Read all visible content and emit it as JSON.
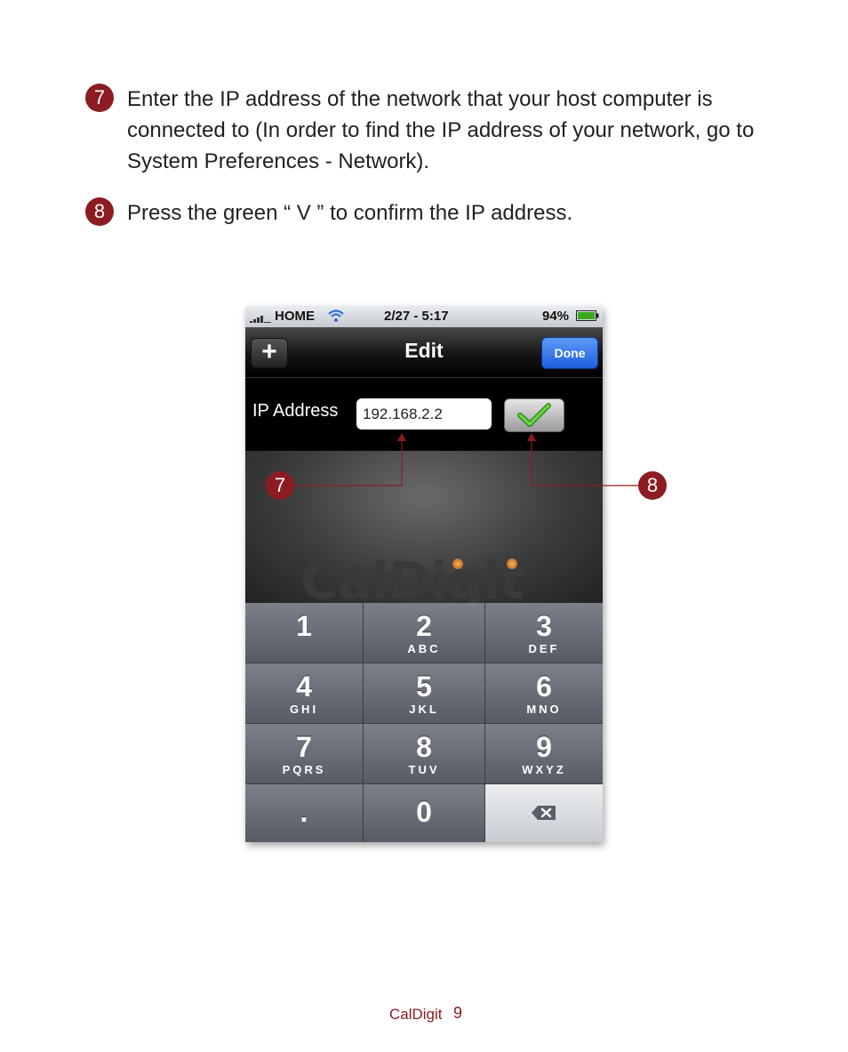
{
  "steps": [
    {
      "number": "7",
      "text": "Enter the IP address of the network that your host computer is connected to (In order to find the IP address of your network, go to System Preferences - Network)."
    },
    {
      "number": "8",
      "text": "Press the green “ V ” to confirm the IP address."
    }
  ],
  "phone": {
    "status": {
      "carrier": "HOME",
      "time": "2/27 - 5:17",
      "battery": "94%"
    },
    "nav": {
      "plus": "+",
      "title": "Edit",
      "done": "Done"
    },
    "ip_label": "IP Address",
    "ip_value": "192.168.2.2",
    "watermark": "CalDigit",
    "keys": [
      {
        "num": "1",
        "letters": ""
      },
      {
        "num": "2",
        "letters": "ABC"
      },
      {
        "num": "3",
        "letters": "DEF"
      },
      {
        "num": "4",
        "letters": "GHI"
      },
      {
        "num": "5",
        "letters": "JKL"
      },
      {
        "num": "6",
        "letters": "MNO"
      },
      {
        "num": "7",
        "letters": "PQRS"
      },
      {
        "num": "8",
        "letters": "TUV"
      },
      {
        "num": "9",
        "letters": "WXYZ"
      },
      {
        "num": ".",
        "letters": ""
      },
      {
        "num": "0",
        "letters": ""
      }
    ]
  },
  "callouts": [
    "7",
    "8"
  ],
  "colors": {
    "accent": "#8c1c22",
    "check": "#3aa91f",
    "done": "#1f5fe0"
  },
  "footer": {
    "brand": "CalDigit",
    "page": "9"
  }
}
